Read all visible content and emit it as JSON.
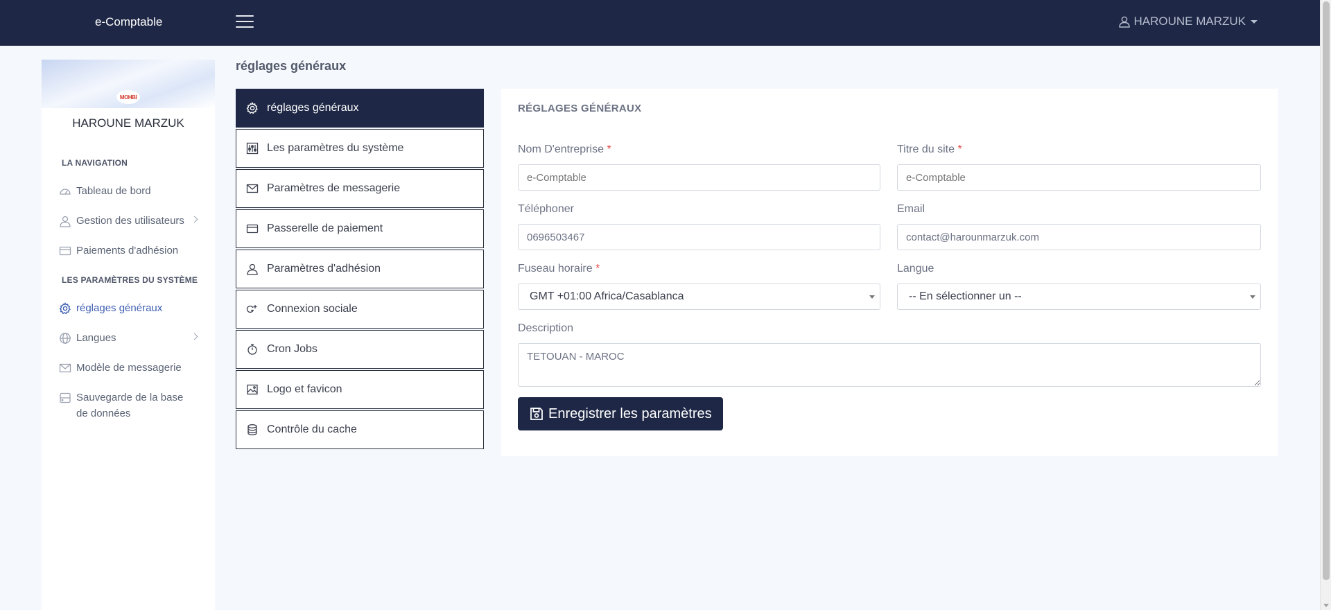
{
  "header": {
    "brand": "e-Comptable",
    "user_name": "HAROUNE MARZUK"
  },
  "sidebar": {
    "logo_text": "MOHBI",
    "profile_name": "HAROUNE MARZUK",
    "section_navigation": "LA NAVIGATION",
    "section_system": "LES PARAMÈTRES DU SYSTÈME",
    "items": [
      {
        "label": "Tableau de bord",
        "icon": "dashboard-icon"
      },
      {
        "label": "Gestion des utilisateurs",
        "icon": "user-icon"
      },
      {
        "label": "Paiements d'adhésion",
        "icon": "credit-card-icon"
      },
      {
        "label": "réglages généraux",
        "icon": "gear-icon"
      },
      {
        "label": "Langues",
        "icon": "globe-icon"
      },
      {
        "label": "Modèle de messagerie",
        "icon": "envelope-icon"
      },
      {
        "label": "Sauvegarde de la base de données",
        "icon": "database-icon"
      }
    ]
  },
  "page": {
    "title": "réglages généraux"
  },
  "settings_menu": {
    "items": [
      {
        "label": "réglages généraux",
        "icon": "gear-icon"
      },
      {
        "label": "Les paramètres du système",
        "icon": "sliders-icon"
      },
      {
        "label": "Paramètres de messagerie",
        "icon": "envelope-icon"
      },
      {
        "label": "Passerelle de paiement",
        "icon": "credit-card-icon"
      },
      {
        "label": "Paramètres d'adhésion",
        "icon": "user-icon"
      },
      {
        "label": "Connexion sociale",
        "icon": "google-plus-icon"
      },
      {
        "label": "Cron Jobs",
        "icon": "stopwatch-icon"
      },
      {
        "label": "Logo et favicon",
        "icon": "image-icon"
      },
      {
        "label": "Contrôle du cache",
        "icon": "database-icon"
      }
    ]
  },
  "form": {
    "card_title": "RÉGLAGES GÉNÉRAUX",
    "company_label": "Nom D'entreprise",
    "company_placeholder": "e-Comptable",
    "site_title_label": "Titre du site",
    "site_title_placeholder": "e-Comptable",
    "phone_label": "Téléphoner",
    "phone_value": "0696503467",
    "email_label": "Email",
    "email_value": "contact@harounmarzuk.com",
    "timezone_label": "Fuseau horaire",
    "timezone_value": "GMT +01:00 Africa/Casablanca",
    "language_label": "Langue",
    "language_value": "-- En sélectionner un --",
    "description_label": "Description",
    "description_value": "TETOUAN - MAROC",
    "required_mark": "*",
    "save_label": "Enregistrer les paramètres"
  },
  "colors": {
    "navbar": "#1e2745",
    "accent": "#3f5fb3",
    "required": "#e54848"
  }
}
